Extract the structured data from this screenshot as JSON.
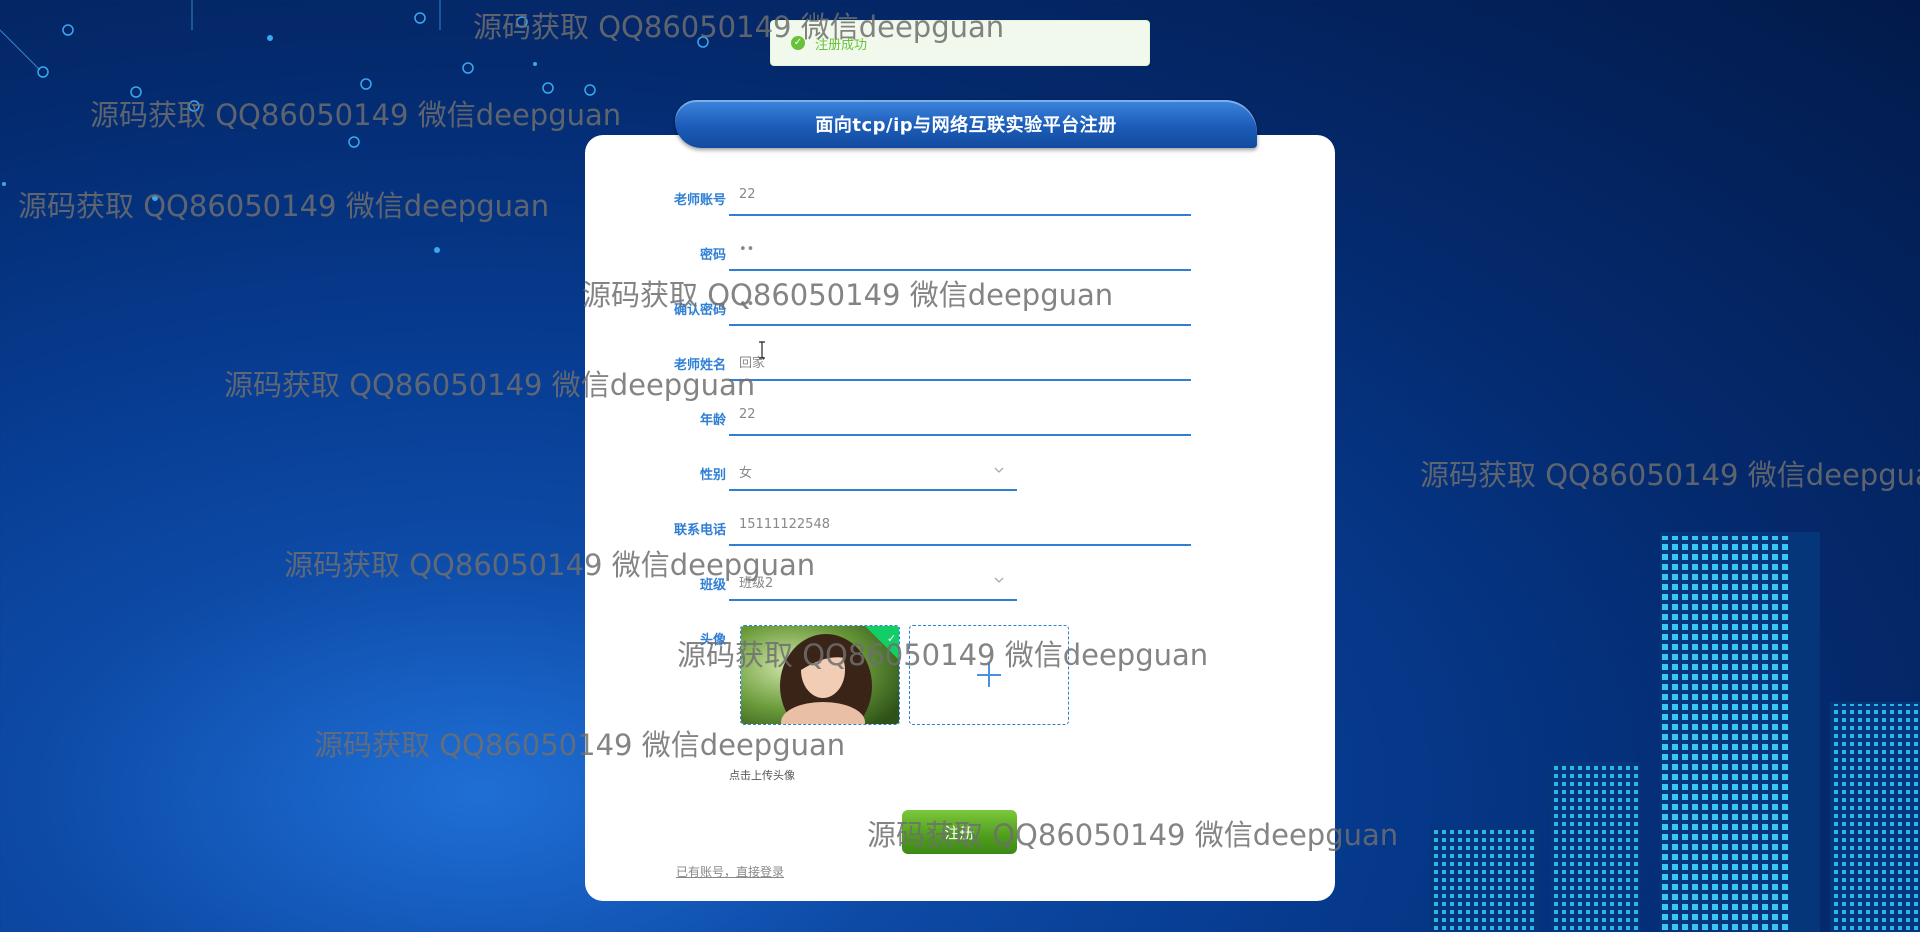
{
  "toast": {
    "message": "注册成功",
    "status": "success"
  },
  "form": {
    "title": "面向tcp/ip与网络互联实验平台注册",
    "fields": [
      {
        "label": "老师账号",
        "value": "22"
      },
      {
        "label": "密码",
        "value": "••"
      },
      {
        "label": "确认密码",
        "value": "••"
      },
      {
        "label": "老师姓名",
        "value": "回家"
      },
      {
        "label": "年龄",
        "value": "22"
      },
      {
        "label": "性别",
        "value": "女"
      },
      {
        "label": "联系电话",
        "value": "15111122548"
      },
      {
        "label": "班级",
        "value": "班级2"
      }
    ],
    "avatar": {
      "label": "头像",
      "upload_tip": "点击上传头像"
    },
    "submit_label": "注册",
    "login_link": "已有账号，直接登录"
  },
  "watermark": "源码获取 QQ86050149 微信deepguan",
  "colors": {
    "accent": "#2f7fd5",
    "success": "#67c23a",
    "submit": "#4e9e1e"
  }
}
